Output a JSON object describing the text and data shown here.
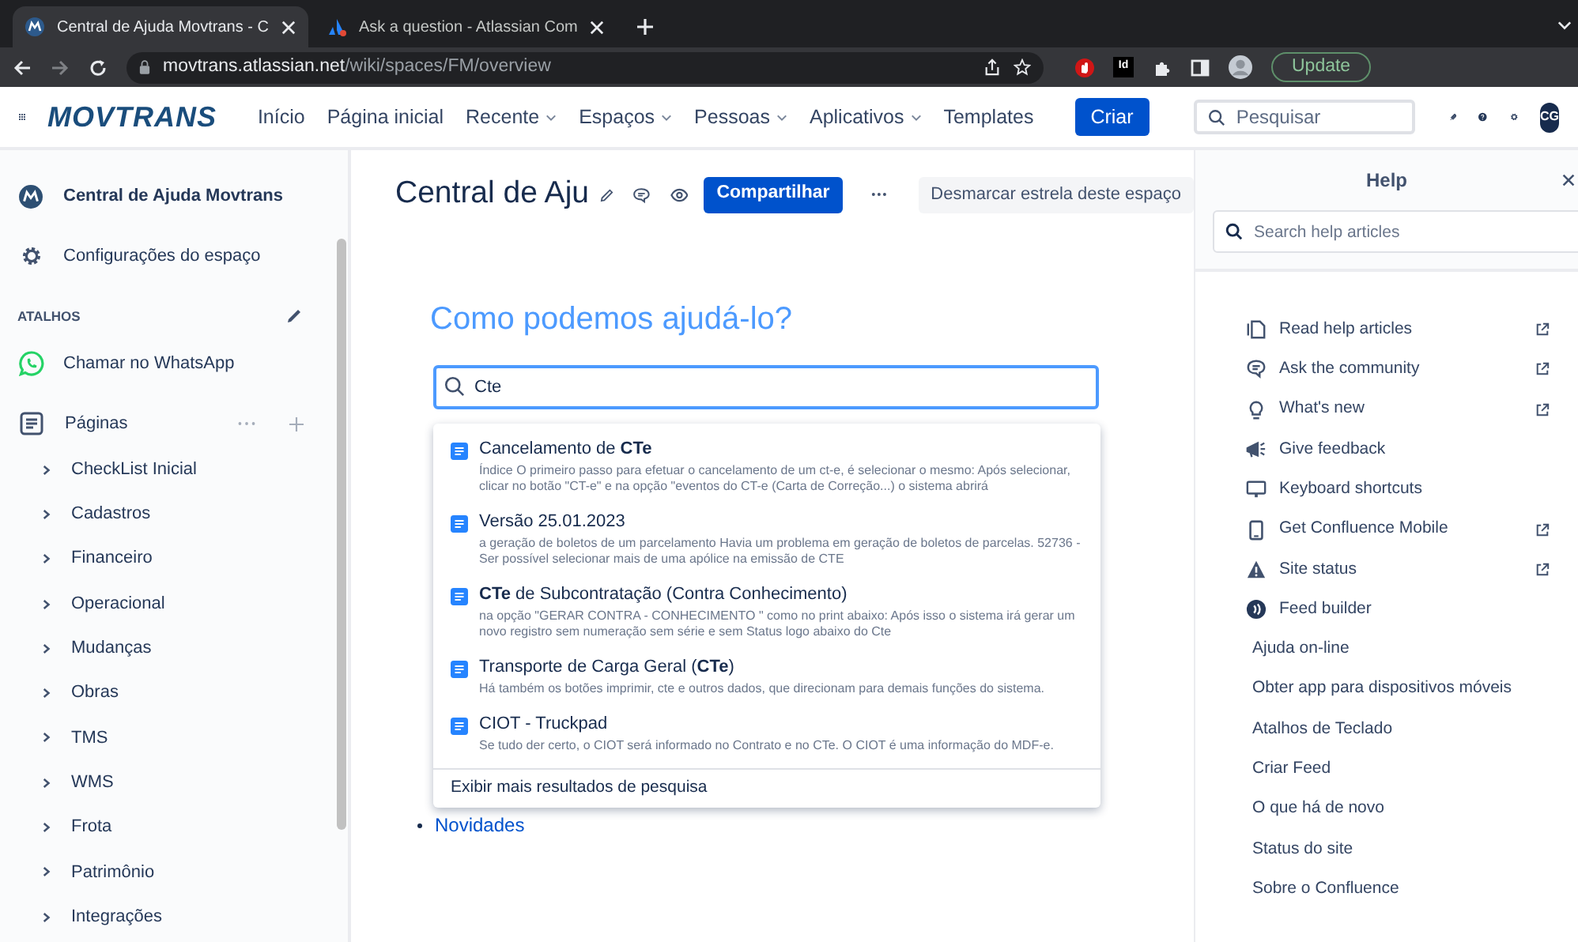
{
  "browser": {
    "tabs": [
      {
        "title": "Central de Ajuda Movtrans - C",
        "selected": true
      },
      {
        "title": "Ask a question - Atlassian Com",
        "selected": false
      }
    ],
    "url": {
      "host": "movtrans.atlassian.net",
      "path": "/wiki/spaces/FM/overview"
    },
    "extension_label": "Id",
    "update_button": "Update"
  },
  "nav": {
    "logo": "MOVTRANS",
    "items": [
      {
        "label": "Início",
        "dropdown": false
      },
      {
        "label": "Página inicial",
        "dropdown": false
      },
      {
        "label": "Recente",
        "dropdown": true
      },
      {
        "label": "Espaços",
        "dropdown": true
      },
      {
        "label": "Pessoas",
        "dropdown": true
      },
      {
        "label": "Aplicativos",
        "dropdown": true
      },
      {
        "label": "Templates",
        "dropdown": false
      }
    ],
    "create": "Criar",
    "search": {
      "placeholder": "Pesquisar"
    },
    "avatar": "CG"
  },
  "sidebar": {
    "space_name": "Central de Ajuda Movtrans",
    "settings": "Configurações do espaço",
    "shortcuts_heading": "ATALHOS",
    "shortcuts": [
      "Chamar no WhatsApp"
    ],
    "pages_label": "Páginas",
    "pages": [
      "CheckList Inicial",
      "Cadastros",
      "Financeiro",
      "Operacional",
      "Mudanças",
      "Obras",
      "TMS",
      "WMS",
      "Frota",
      "Patrimônio",
      "Integrações"
    ]
  },
  "main": {
    "title": "Central de Aju",
    "share": "Compartilhar",
    "unstar": "Desmarcar estrela deste espaço",
    "heading": "Como podemos ajudá-lo?",
    "search": {
      "value": "Cte"
    },
    "results": [
      {
        "title": "Cancelamento de **CTe**",
        "snippet": "Índice O primeiro passo para efetuar o cancelamento de um ct-e, é selecionar o mesmo: Após selecionar, clicar no botão \"CT-e\" e na opção \"eventos do CT-e (Carta de Correção...) o sistema abrirá"
      },
      {
        "title": "Versão 25.01.2023",
        "snippet": "a geração de boletos de um parcelamento Havia um problema em geração de boletos de parcelas. 52736 - Ser possível selecionar mais de uma apólice na emissão de CTE"
      },
      {
        "title": "**CTe** de Subcontratação (Contra Conhecimento)",
        "snippet": "na opção \"GERAR CONTRA - CONHECIMENTO \" como no print abaixo: Após isso o sistema irá gerar um novo registro sem numeração sem série e sem Status logo abaixo do Cte"
      },
      {
        "title": "Transporte de Carga Geral (**CTe**)",
        "snippet": "Há também os botões imprimir, cte e outros dados, que direcionam para demais funções do sistema."
      },
      {
        "title": "CIOT - Truckpad",
        "snippet": "Se tudo der certo, o CIOT será informado no Contrato e no CTe. O CIOT é uma informação do MDF-e."
      }
    ],
    "more_results": "Exibir mais resultados de pesquisa",
    "link": "Novidades"
  },
  "help": {
    "title": "Help",
    "search": {
      "placeholder": "Search help articles"
    },
    "items": [
      {
        "label": "Read help articles",
        "kind": "read",
        "external": true
      },
      {
        "label": "Ask the community",
        "kind": "community",
        "external": true
      },
      {
        "label": "What's new",
        "kind": "new",
        "external": true
      },
      {
        "label": "Give feedback",
        "kind": "feedback",
        "external": false
      },
      {
        "label": "Keyboard shortcuts",
        "kind": "keyboard",
        "external": false
      },
      {
        "label": "Get Confluence Mobile",
        "kind": "mobile",
        "external": true
      },
      {
        "label": "Site status",
        "kind": "status",
        "external": true
      },
      {
        "label": "Feed builder",
        "kind": "feed",
        "external": false
      }
    ],
    "links": [
      "Ajuda on-line",
      "Obter app para dispositivos móveis",
      "Atalhos de Teclado",
      "Criar Feed",
      "O que há de novo",
      "Status do site",
      "Sobre o Confluence"
    ]
  }
}
